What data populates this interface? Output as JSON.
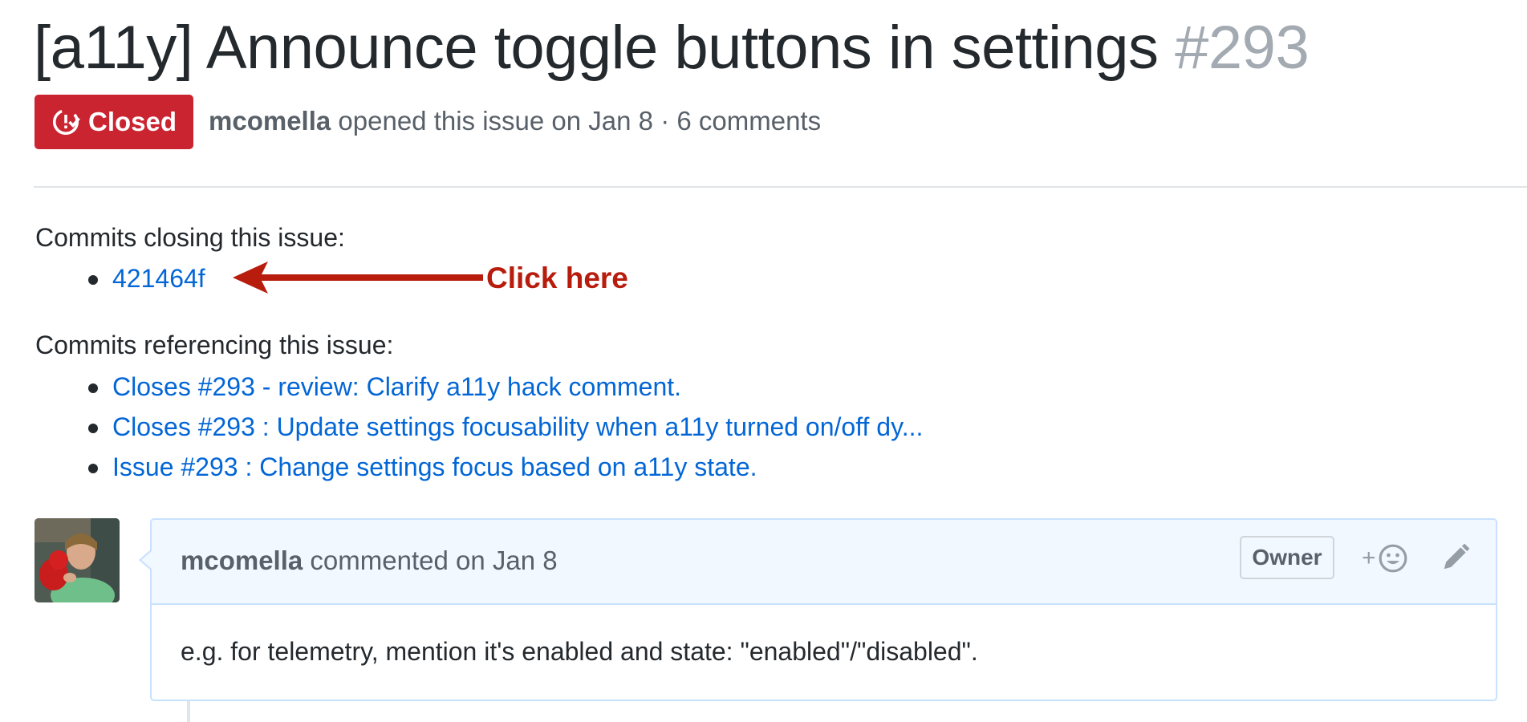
{
  "issue": {
    "title": "[a11y] Announce toggle buttons in settings",
    "number": "#293",
    "status": "Closed",
    "author": "mcomella",
    "opened_text": "opened this issue on Jan 8 · 6 comments"
  },
  "closing_commits": {
    "heading": "Commits closing this issue:",
    "items": [
      "421464f"
    ]
  },
  "annotation": {
    "label": "Click here",
    "color": "#b71c0c"
  },
  "referencing_commits": {
    "heading": "Commits referencing this issue:",
    "items": [
      "Closes #293 - review: Clarify a11y hack comment.",
      "Closes #293 : Update settings focusability when a11y turned on/off dy...",
      "Issue #293 : Change settings focus based on a11y state."
    ]
  },
  "comment": {
    "author": "mcomella",
    "meta_text": "commented on Jan 8",
    "role_badge": "Owner",
    "reaction_label": "+",
    "body": "e.g. for telemetry, mention it's enabled and state: \"enabled\"/\"disabled\"."
  },
  "colors": {
    "closed": "#cb2431",
    "link": "#0366d6",
    "muted": "#586069",
    "comment_border": "#c8e1ff",
    "comment_header_bg": "#f1f8ff"
  },
  "icons": [
    "issue-closed-icon",
    "smiley-icon",
    "pencil-icon",
    "arrow-left-icon"
  ]
}
